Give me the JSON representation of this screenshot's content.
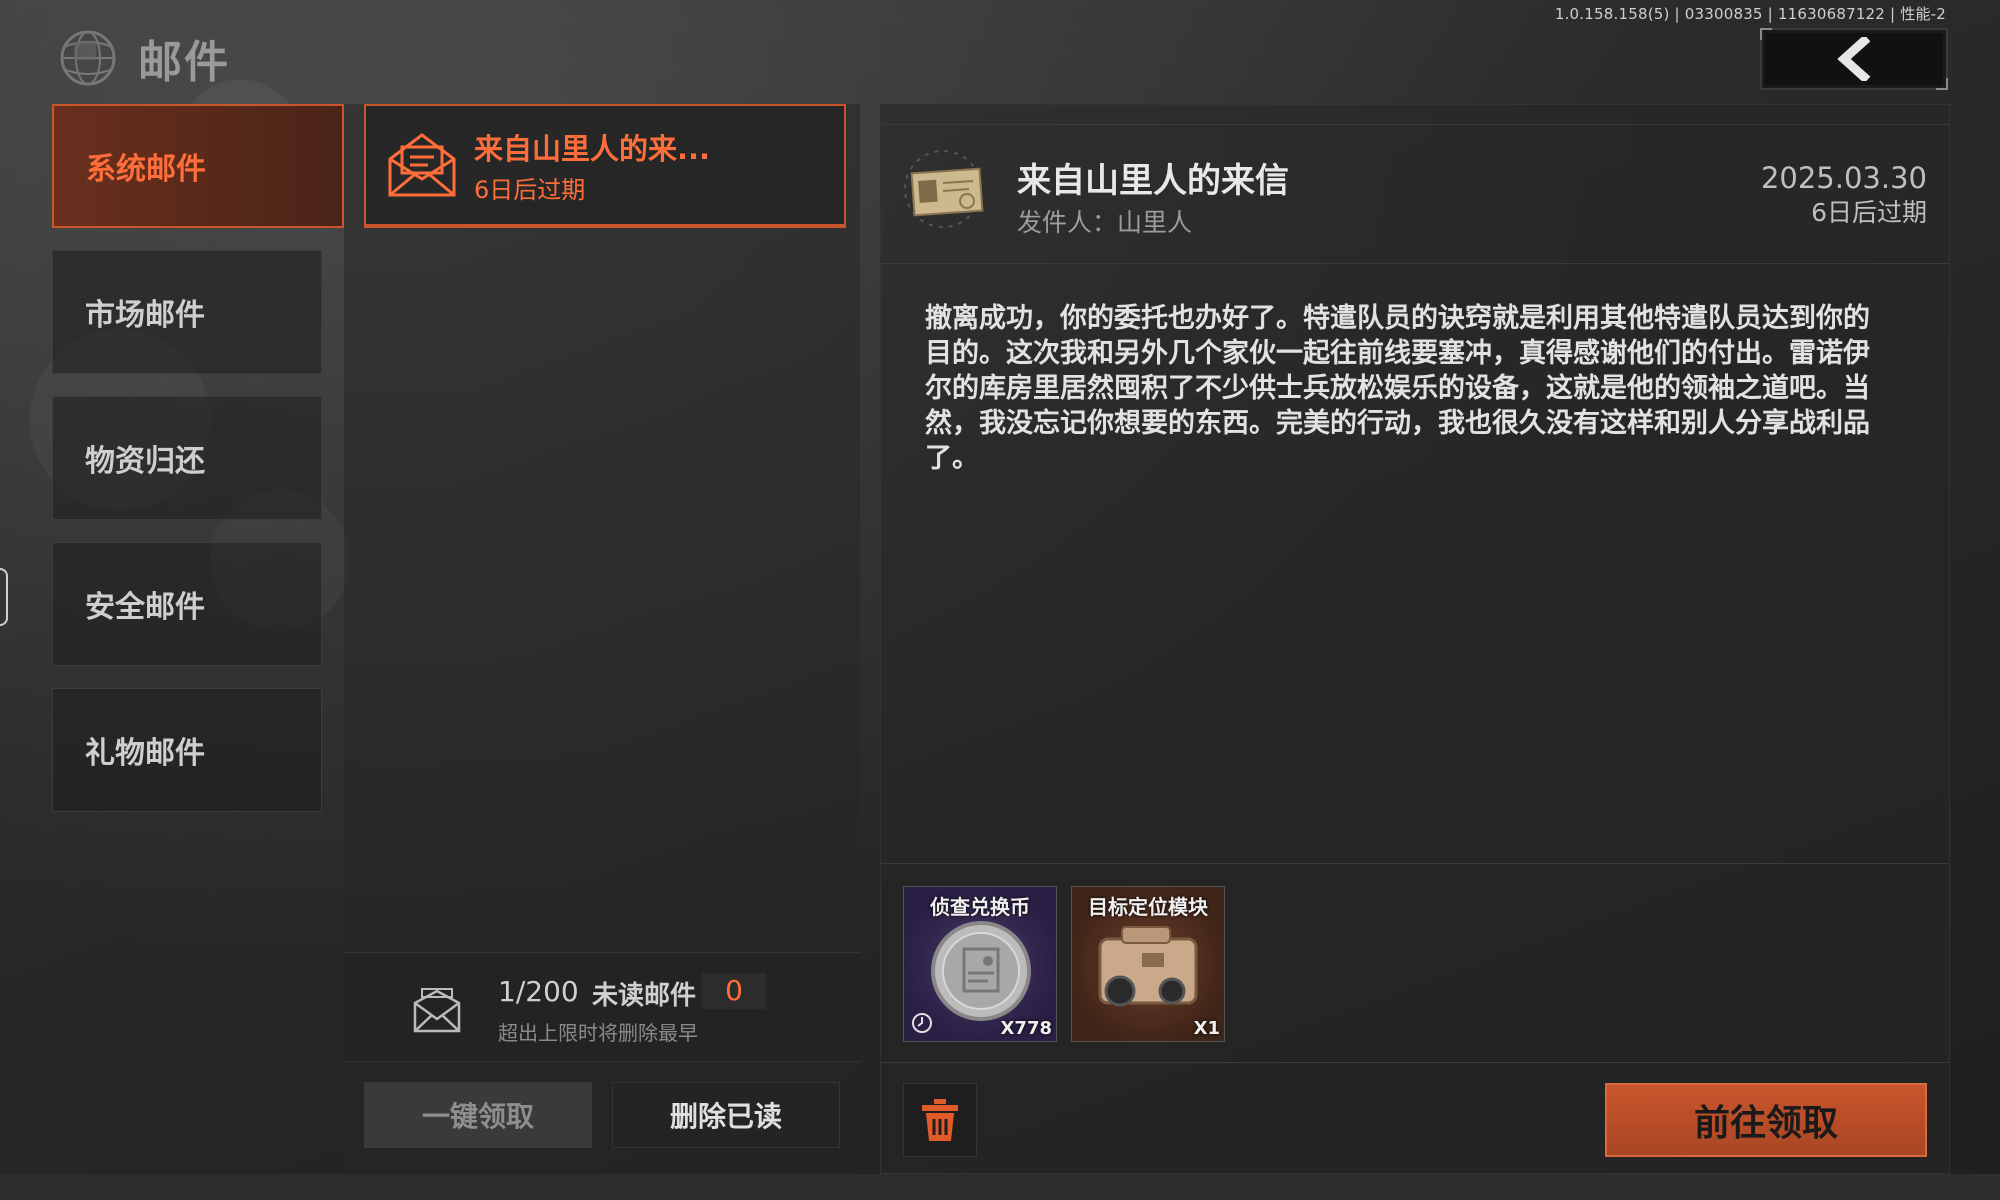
{
  "version": "1.0.158.158(5) | 03300835 | 11630687122 | 性能-2",
  "header": {
    "title": "邮件"
  },
  "nav": {
    "items": [
      {
        "label": "系统邮件",
        "active": true
      },
      {
        "label": "市场邮件",
        "active": false
      },
      {
        "label": "物资归还",
        "active": false
      },
      {
        "label": "安全邮件",
        "active": false
      },
      {
        "label": "礼物邮件",
        "active": false
      }
    ]
  },
  "mail_list": {
    "items": [
      {
        "subject": "来自山里人的来...",
        "expire": "6日后过期"
      }
    ],
    "footer": {
      "count": "1/200",
      "unread_label": "未读邮件",
      "unread_count": "0",
      "limit_note": "超出上限时将删除最早"
    },
    "claim_all_label": "一键领取",
    "delete_read_label": "删除已读"
  },
  "detail": {
    "title": "来自山里人的来信",
    "sender": "发件人：山里人",
    "date": "2025.03.30",
    "expire": "6日后过期",
    "body": "撤离成功，你的委托也办好了。特遣队员的诀窍就是利用其他特遣队员达到你的目的。这次我和另外几个家伙一起往前线要塞冲，真得感谢他们的付出。雷诺伊尔的库房里居然囤积了不少供士兵放松娱乐的设备，这就是他的领袖之道吧。当然，我没忘记你想要的东西。完美的行动，我也很久没有这样和别人分享战利品了。",
    "attachments": [
      {
        "name": "侦查兑换币",
        "qty": "X778",
        "icon": "coin-icon"
      },
      {
        "name": "目标定位模块",
        "qty": "X1",
        "icon": "laser-module-icon"
      }
    ],
    "go_claim_label": "前往领取"
  },
  "colors": {
    "accent": "#c9552c",
    "accent_text": "#ff6e3a"
  }
}
